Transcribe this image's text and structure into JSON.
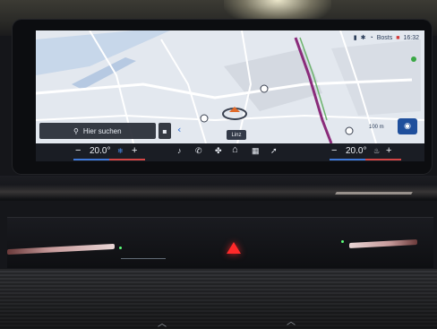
{
  "status": {
    "wifi_label": "Bosts",
    "time": "16:32"
  },
  "map": {
    "search_placeholder": "Hier suchen",
    "nearby_label": "Linz",
    "scale_label": "100 m",
    "route_color": "#8a2b7a",
    "road_color": "#ffffff",
    "water_color": "#c7d7ea"
  },
  "climate": {
    "left_temp": "20.0°",
    "right_temp": "20.0°",
    "minus": "−",
    "plus": "+"
  },
  "colors": {
    "hazard": "#ff2a2a",
    "accent_blue": "#2e6fd8"
  }
}
